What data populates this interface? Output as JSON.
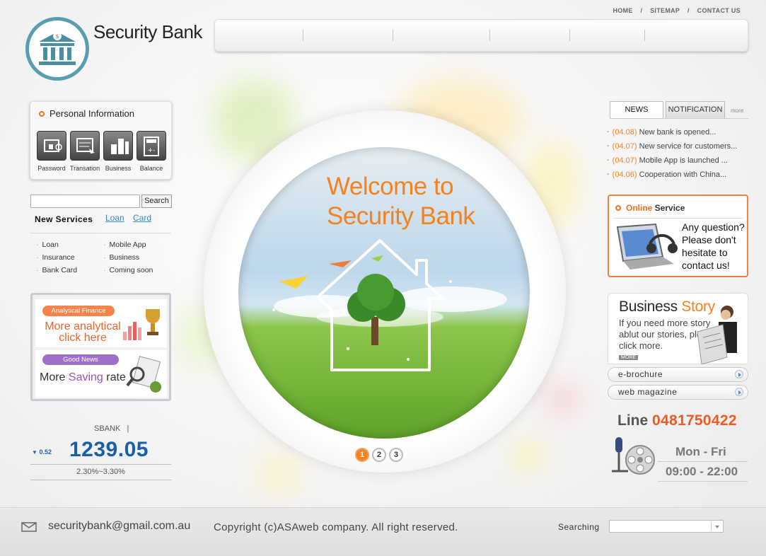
{
  "header": {
    "title": "Security Bank",
    "links": [
      "HOME",
      "SITEMAP",
      "CONTACT US"
    ],
    "link_separator": "/"
  },
  "personal_info": {
    "title": "Personal Information",
    "buttons": [
      {
        "label": "Password",
        "icon": "password-icon"
      },
      {
        "label": "Transation",
        "icon": "transaction-icon"
      },
      {
        "label": "Business",
        "icon": "business-icon"
      },
      {
        "label": "Balance",
        "icon": "calculator-icon"
      }
    ]
  },
  "search": {
    "value": "",
    "button_label": "Search"
  },
  "new_services": {
    "title": "New Services",
    "links": [
      "Loan",
      "Card"
    ],
    "items_left": [
      "Loan",
      "Insurance",
      "Bank Card"
    ],
    "items_right": [
      "Mobile App",
      "Business",
      "Coming soon"
    ]
  },
  "promos": [
    {
      "badge": "Analytical Finance",
      "line1": "More analytical",
      "line2": "click here",
      "badge_color": "#f4854a"
    },
    {
      "badge": "Good News",
      "text_a": "More ",
      "text_b": "Saving",
      "text_c": " rate",
      "badge_color": "#a070c8"
    }
  ],
  "stock": {
    "name": "SBANK",
    "divider": "|",
    "change": "0.52",
    "value": "1239.05",
    "range": "2.30%~3.30%"
  },
  "hero": {
    "line1": "Welcome to",
    "line2": "Security Bank",
    "slides": [
      "1",
      "2",
      "3"
    ],
    "active_slide": 1
  },
  "news": {
    "tabs": [
      "NEWS",
      "NOTIFICATION"
    ],
    "more": "more",
    "items": [
      {
        "date": "(04.08)",
        "text": "New bank is  opened..."
      },
      {
        "date": "(04.07)",
        "text": "New service for customers..."
      },
      {
        "date": "(04.07)",
        "text": "Mobile App is launched ..."
      },
      {
        "date": "(04.06)",
        "text": "Cooperation with China..."
      }
    ]
  },
  "online_service": {
    "title_accent": "Online",
    "title_rest": " Service",
    "message": "Any question? Please don't hesitate to contact us!"
  },
  "business_story": {
    "title_a": "Business",
    "title_b": " Story",
    "text": "If you need more story ablut our stories, please click more.",
    "more": "MORE"
  },
  "links": [
    "e-brochure",
    "web magazine"
  ],
  "contact": {
    "line_label": "Line",
    "line_number": "0481750422",
    "days": "Mon - Fri",
    "hours": "09:00 - 22:00"
  },
  "footer": {
    "email": "securitybank@gmail.com.au",
    "copyright": "Copyright (c)ASAweb company. All right reserved.",
    "search_label": "Searching",
    "select_value": ""
  },
  "colors": {
    "accent": "#f5821f",
    "brand": "#5a9db0",
    "stock": "#1a5faa"
  }
}
